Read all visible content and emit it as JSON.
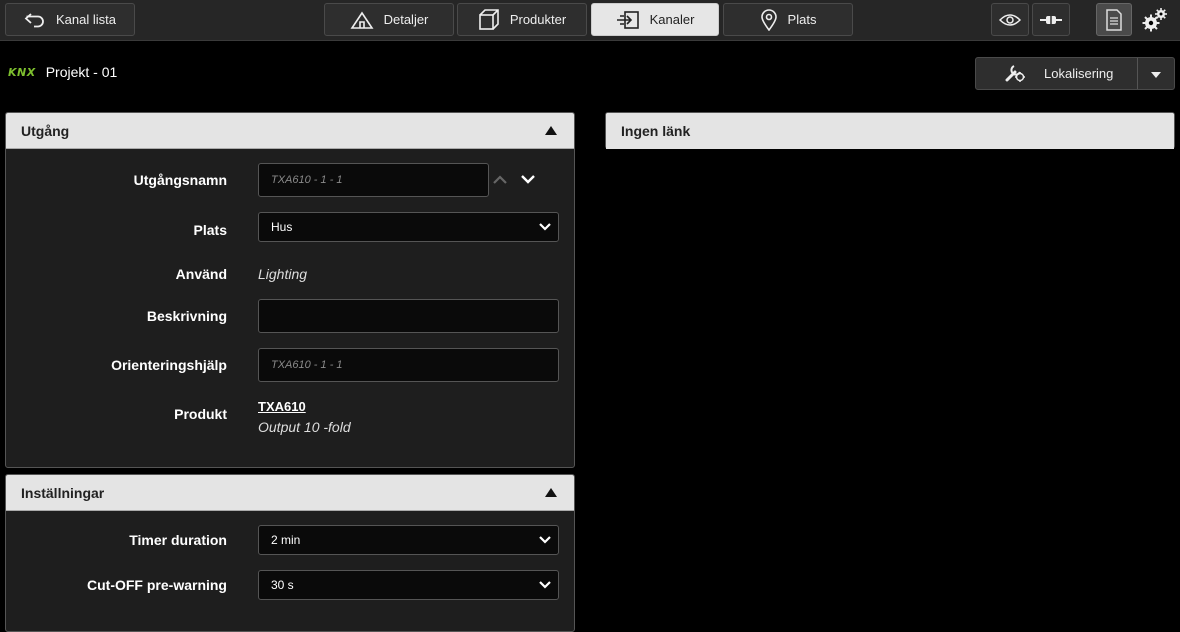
{
  "toolbar": {
    "back_label": "Kanal lista",
    "tabs": [
      {
        "label": "Detaljer",
        "icon": "home-icon"
      },
      {
        "label": "Produkter",
        "icon": "box-icon"
      },
      {
        "label": "Kanaler",
        "icon": "channel-icon",
        "active": true
      },
      {
        "label": "Plats",
        "icon": "location-pin-icon"
      }
    ]
  },
  "project": {
    "logo": "KNX",
    "title": "Projekt - 01"
  },
  "localize": {
    "label": "Lokalisering"
  },
  "output_panel": {
    "title": "Utgång",
    "fields": {
      "name_label": "Utgångsnamn",
      "name_placeholder": "TXA610 - 1 - 1",
      "place_label": "Plats",
      "place_value": "Hus",
      "use_label": "Använd",
      "use_value": "Lighting",
      "desc_label": "Beskrivning",
      "desc_value": "",
      "orient_label": "Orienteringshjälp",
      "orient_placeholder": "TXA610 - 1 - 1",
      "product_label": "Produkt",
      "product_name": "TXA610",
      "product_desc": "Output 10 -fold"
    }
  },
  "settings_panel": {
    "title": "Inställningar",
    "timer_label": "Timer duration",
    "timer_value": "2 min",
    "cutoff_label": "Cut-OFF pre-warning",
    "cutoff_value": "30 s"
  },
  "link_panel": {
    "title": "Ingen länk"
  },
  "colors": {
    "accent_knx": "#7dbf2e",
    "header_bg": "#e4e4e4",
    "panel_bg": "#1e1e1e"
  }
}
